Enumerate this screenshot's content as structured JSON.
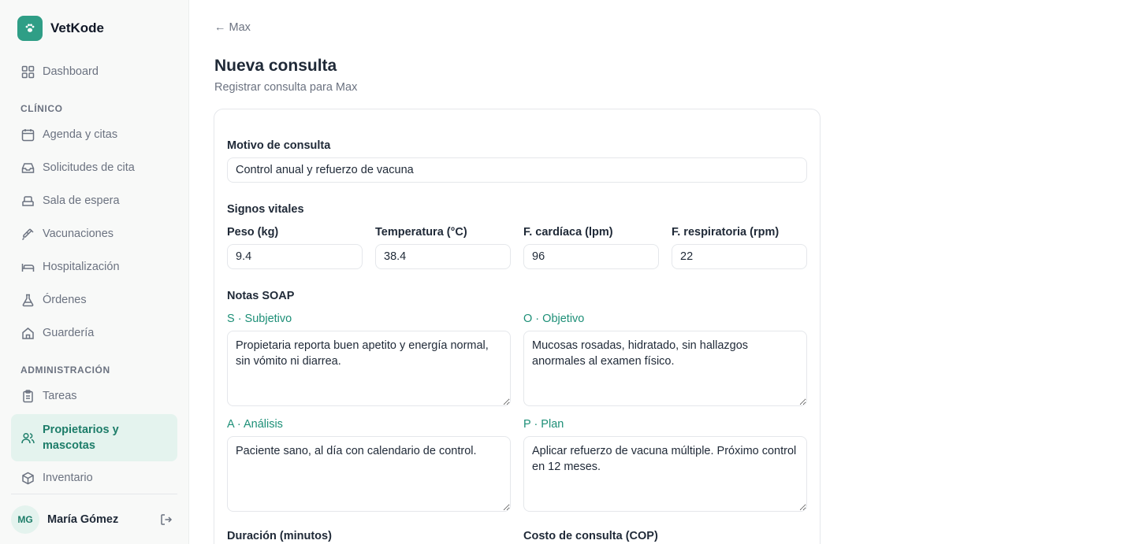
{
  "brand": {
    "name": "VetKode",
    "logo_icon": "paw-icon",
    "accent": "#2f9e86"
  },
  "sidebar": {
    "top_items": [
      {
        "label": "Dashboard",
        "icon": "grid-icon"
      }
    ],
    "sections": [
      {
        "label": "CLÍNICO",
        "items": [
          {
            "label": "Agenda y citas",
            "icon": "calendar-icon"
          },
          {
            "label": "Solicitudes de cita",
            "icon": "inbox-icon"
          },
          {
            "label": "Sala de espera",
            "icon": "waiting-icon"
          },
          {
            "label": "Vacunaciones",
            "icon": "syringe-icon"
          },
          {
            "label": "Hospitalización",
            "icon": "bed-icon"
          },
          {
            "label": "Órdenes",
            "icon": "flask-icon"
          },
          {
            "label": "Guardería",
            "icon": "home-icon"
          }
        ]
      },
      {
        "label": "ADMINISTRACIÓN",
        "items": [
          {
            "label": "Tareas",
            "icon": "clipboard-icon"
          },
          {
            "label": "Propietarios y mascotas",
            "icon": "users-icon",
            "active": true
          },
          {
            "label": "Inventario",
            "icon": "box-icon"
          }
        ]
      }
    ],
    "user": {
      "initials": "MG",
      "name": "María Gómez",
      "logout_icon": "logout-icon"
    }
  },
  "page": {
    "back_link": "← Max",
    "title": "Nueva consulta",
    "subtitle": "Registrar consulta para Max"
  },
  "form": {
    "reason": {
      "label": "Motivo de consulta",
      "value": "Control anual y refuerzo de vacuna"
    },
    "vitals": {
      "heading": "Signos vitales",
      "weight": {
        "label": "Peso (kg)",
        "value": "9.4"
      },
      "temperature": {
        "label": "Temperatura (°C)",
        "value": "38.4"
      },
      "heart_rate": {
        "label": "F. cardíaca (lpm)",
        "value": "96"
      },
      "resp_rate": {
        "label": "F. respiratoria (rpm)",
        "value": "22"
      }
    },
    "soap": {
      "heading": "Notas SOAP",
      "subjective": {
        "label": "S · Subjetivo",
        "value": "Propietaria reporta buen apetito y energía normal, sin vómito ni diarrea."
      },
      "objective": {
        "label": "O · Objetivo",
        "value": "Mucosas rosadas, hidratado, sin hallazgos anormales al examen físico."
      },
      "analysis": {
        "label": "A · Análisis",
        "value": "Paciente sano, al día con calendario de control."
      },
      "plan": {
        "label": "P · Plan",
        "value": "Aplicar refuerzo de vacuna múltiple. Próximo control en 12 meses."
      }
    },
    "duration": {
      "label": "Duración (minutos)"
    },
    "cost": {
      "label": "Costo de consulta (COP)"
    }
  }
}
